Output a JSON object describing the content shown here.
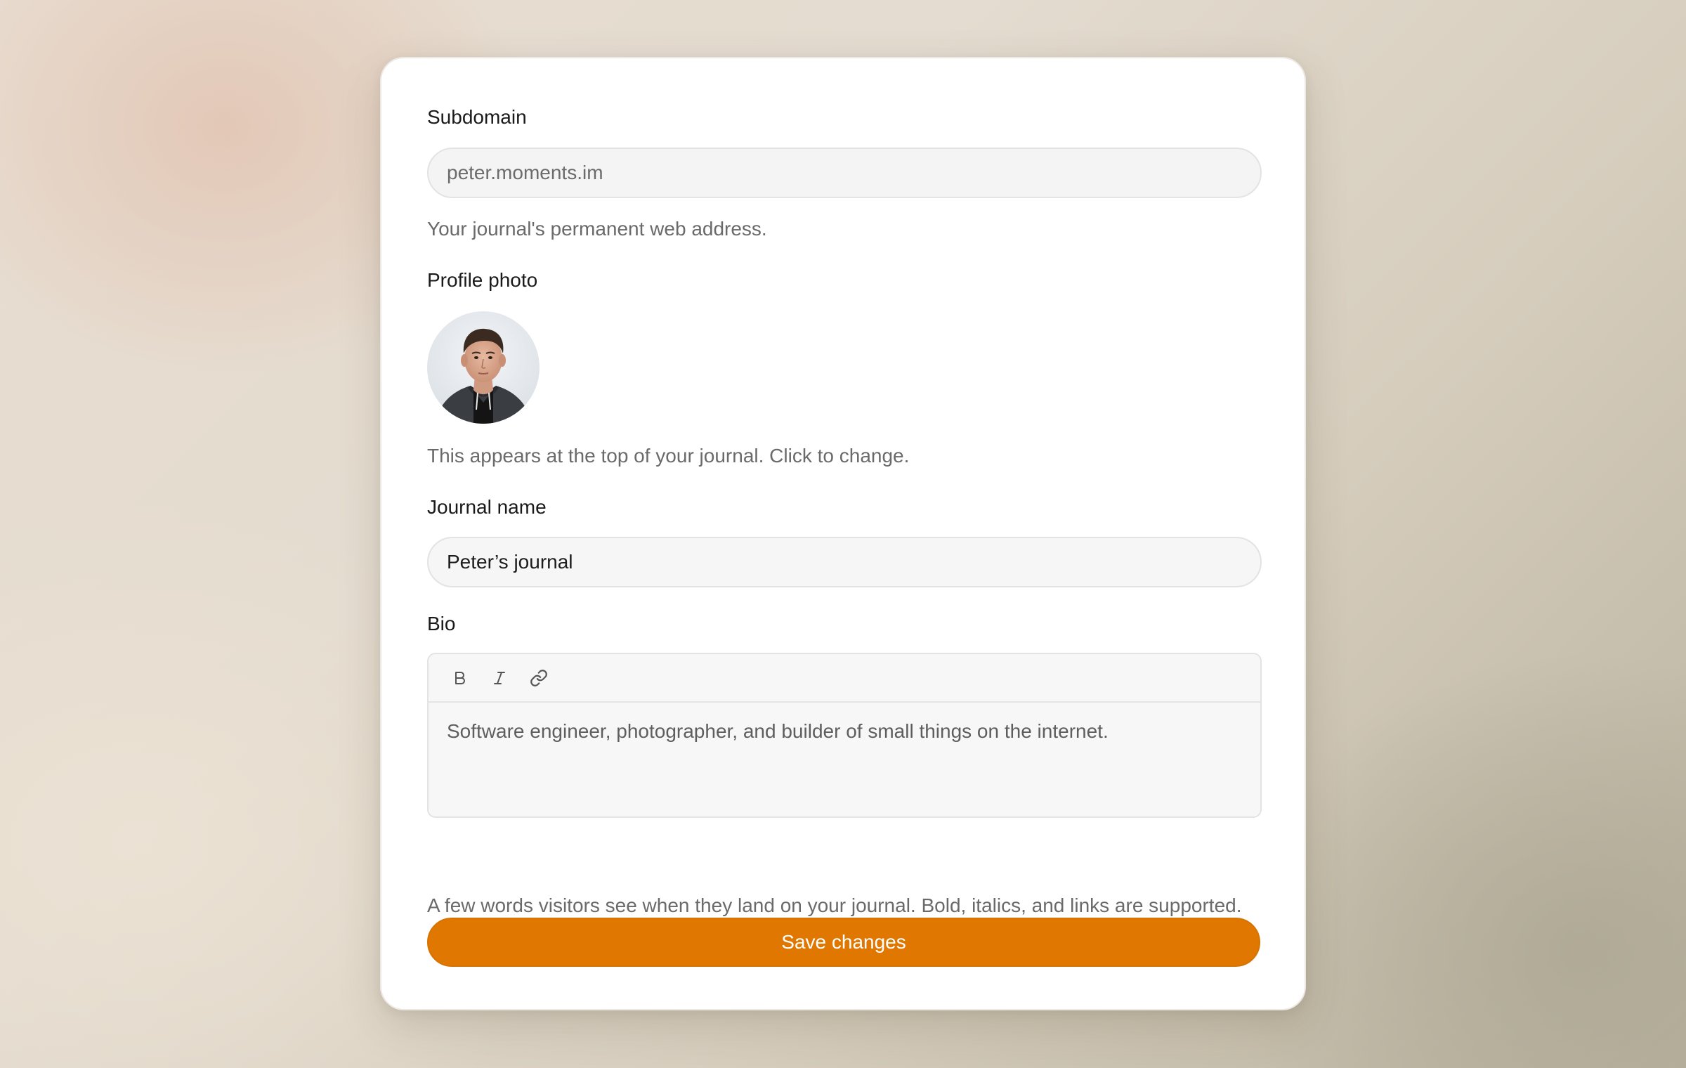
{
  "form": {
    "subdomain": {
      "label": "Subdomain",
      "value": "peter.moments.im",
      "help": "Your journal's permanent web address."
    },
    "profile_photo": {
      "label": "Profile photo",
      "help": "This appears at the top of your journal. Click to change."
    },
    "journal_name": {
      "label": "Journal name",
      "value": "Peter’s journal"
    },
    "bio": {
      "label": "Bio",
      "toolbar": [
        "bold-icon",
        "italic-icon",
        "link-icon"
      ],
      "value": "Software engineer, photographer, and builder of small things on the internet.",
      "help": "A few words visitors see when they land on your journal. Bold, italics, and links are supported."
    },
    "save_label": "Save changes"
  },
  "colors": {
    "accent": "#df7700",
    "card_background": "#ffffff",
    "field_background": "#f4f4f4"
  }
}
